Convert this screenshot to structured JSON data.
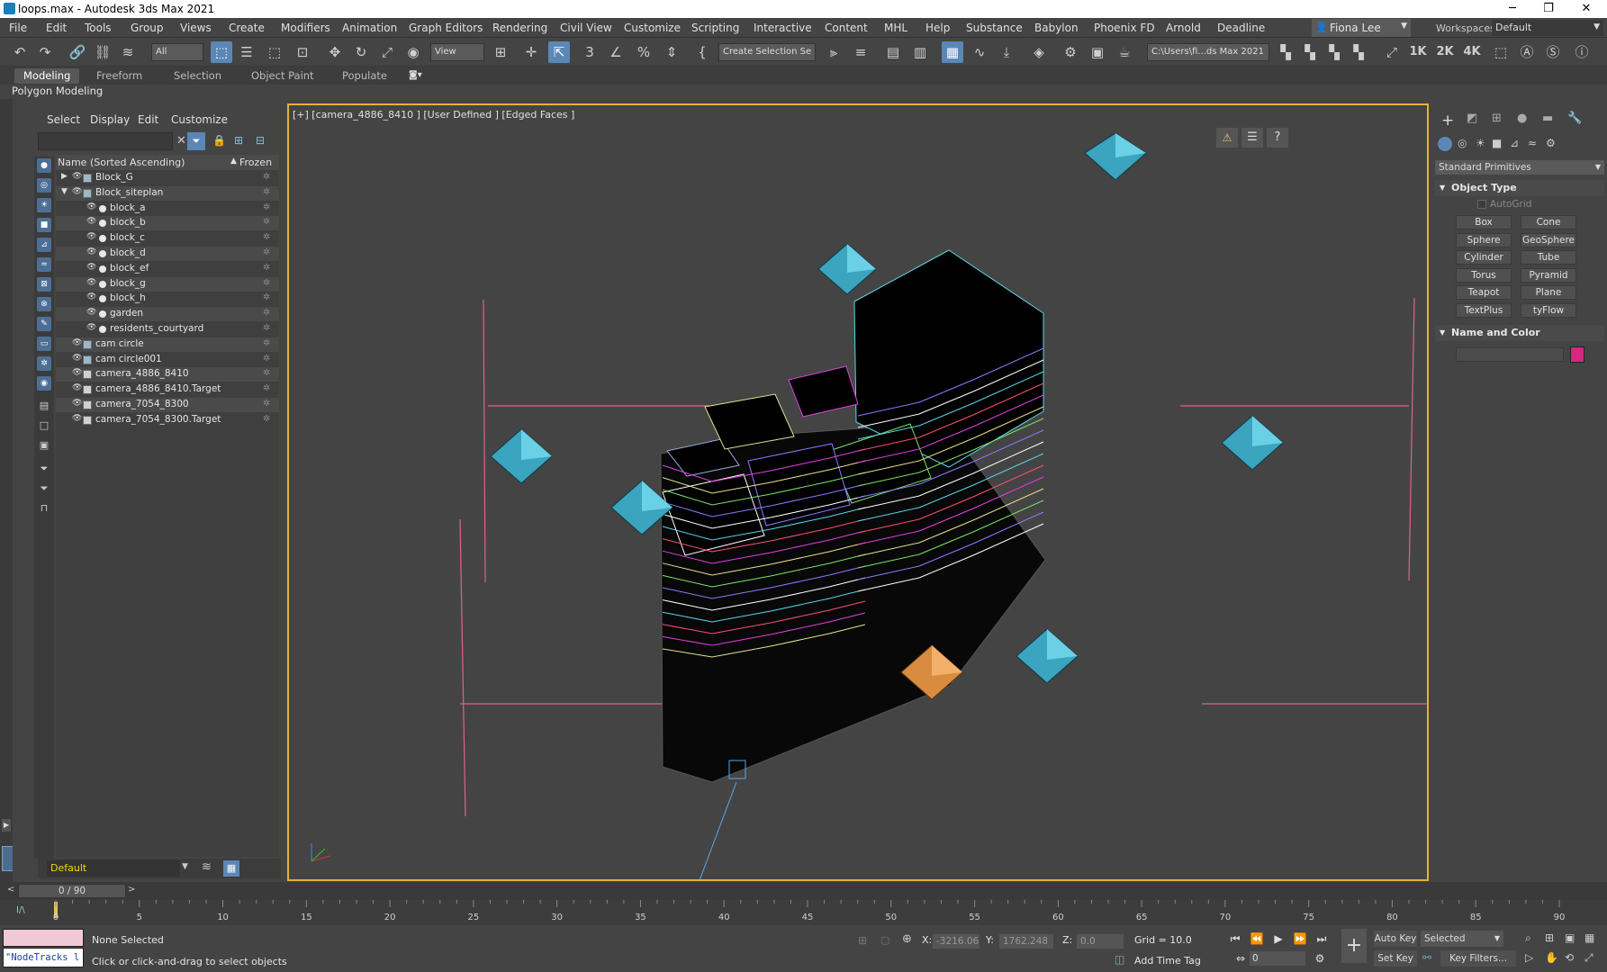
{
  "window": {
    "title": "loops.max - Autodesk 3ds Max 2021"
  },
  "menu": [
    "File",
    "Edit",
    "Tools",
    "Group",
    "Views",
    "Create",
    "Modifiers",
    "Animation",
    "Graph Editors",
    "Rendering",
    "Civil View",
    "Customize",
    "Scripting",
    "Interactive",
    "Content",
    "MHL",
    "Help",
    "Substance",
    "Babylon",
    "Phoenix FD",
    "Arnold",
    "Deadline"
  ],
  "user": {
    "name": "Fiona Lee"
  },
  "workspace": {
    "label": "Workspaces:",
    "value": "Default"
  },
  "toolbar": {
    "filter_value": "All",
    "ref_coord": "View",
    "selection_set": "Create Selection Se",
    "project_path": "C:\\Users\\fi...ds Max 2021",
    "res_1k": "1K",
    "res_2k": "2K",
    "res_4k": "4K"
  },
  "ribbon": {
    "tabs": [
      "Modeling",
      "Freeform",
      "Selection",
      "Object Paint",
      "Populate"
    ],
    "sub": "Polygon Modeling"
  },
  "scene_explorer": {
    "menu": [
      "Select",
      "Display",
      "Edit",
      "Customize"
    ],
    "col_name": "Name (Sorted Ascending)",
    "col_frozen": "Frozen",
    "rows": [
      {
        "name": "Block_G",
        "level": 0,
        "type": "group",
        "expander": "▶"
      },
      {
        "name": "Block_siteplan",
        "level": 0,
        "type": "group",
        "expander": "▼"
      },
      {
        "name": "block_a",
        "level": 1,
        "type": "object",
        "expander": ""
      },
      {
        "name": "block_b",
        "level": 1,
        "type": "object",
        "expander": ""
      },
      {
        "name": "block_c",
        "level": 1,
        "type": "object",
        "expander": ""
      },
      {
        "name": "block_d",
        "level": 1,
        "type": "object",
        "expander": ""
      },
      {
        "name": "block_ef",
        "level": 1,
        "type": "object",
        "expander": ""
      },
      {
        "name": "block_g",
        "level": 1,
        "type": "object",
        "expander": ""
      },
      {
        "name": "block_h",
        "level": 1,
        "type": "object",
        "expander": ""
      },
      {
        "name": "garden",
        "level": 1,
        "type": "object",
        "expander": ""
      },
      {
        "name": "residents_courtyard",
        "level": 1,
        "type": "object",
        "expander": ""
      },
      {
        "name": "cam circle",
        "level": 0,
        "type": "group",
        "expander": ""
      },
      {
        "name": "cam circle001",
        "level": 0,
        "type": "group",
        "expander": ""
      },
      {
        "name": "camera_4886_8410",
        "level": 0,
        "type": "camera",
        "expander": ""
      },
      {
        "name": "camera_4886_8410.Target",
        "level": 0,
        "type": "camera",
        "expander": ""
      },
      {
        "name": "camera_7054_8300",
        "level": 0,
        "type": "camera",
        "expander": ""
      },
      {
        "name": "camera_7054_8300.Target",
        "level": 0,
        "type": "camera",
        "expander": ""
      }
    ],
    "layer": "Default"
  },
  "viewport": {
    "label": "[+] [camera_4886_8410 ] [User Defined ] [Edged Faces ]"
  },
  "command_panel": {
    "category": "Standard Primitives",
    "object_type": "Object Type",
    "autogrid": "AutoGrid",
    "primitives": [
      "Box",
      "Cone",
      "Sphere",
      "GeoSphere",
      "Cylinder",
      "Tube",
      "Torus",
      "Pyramid",
      "Teapot",
      "Plane",
      "TextPlus",
      "tyFlow"
    ],
    "name_and_color": "Name and Color",
    "object_color": "#d6287f"
  },
  "timeline": {
    "frame": "0 / 90",
    "ticks": [
      "0",
      "5",
      "10",
      "15",
      "20",
      "25",
      "30",
      "35",
      "40",
      "45",
      "50",
      "55",
      "60",
      "65",
      "70",
      "75",
      "80",
      "85",
      "90"
    ]
  },
  "status": {
    "maxscript": "\"NodeTracks l",
    "selection": "None Selected",
    "prompt": "Click or click-and-drag to select objects",
    "x_label": "X:",
    "x": "-3216.06",
    "y_label": "Y:",
    "y": "1762.248",
    "z_label": "Z:",
    "z": "0.0",
    "grid": "Grid = 10.0",
    "add_time_tag": "Add Time Tag",
    "auto_key": "Auto Key",
    "set_key": "Set Key",
    "key_mode": "Selected",
    "key_filters": "Key Filters...",
    "current_frame": "0"
  }
}
